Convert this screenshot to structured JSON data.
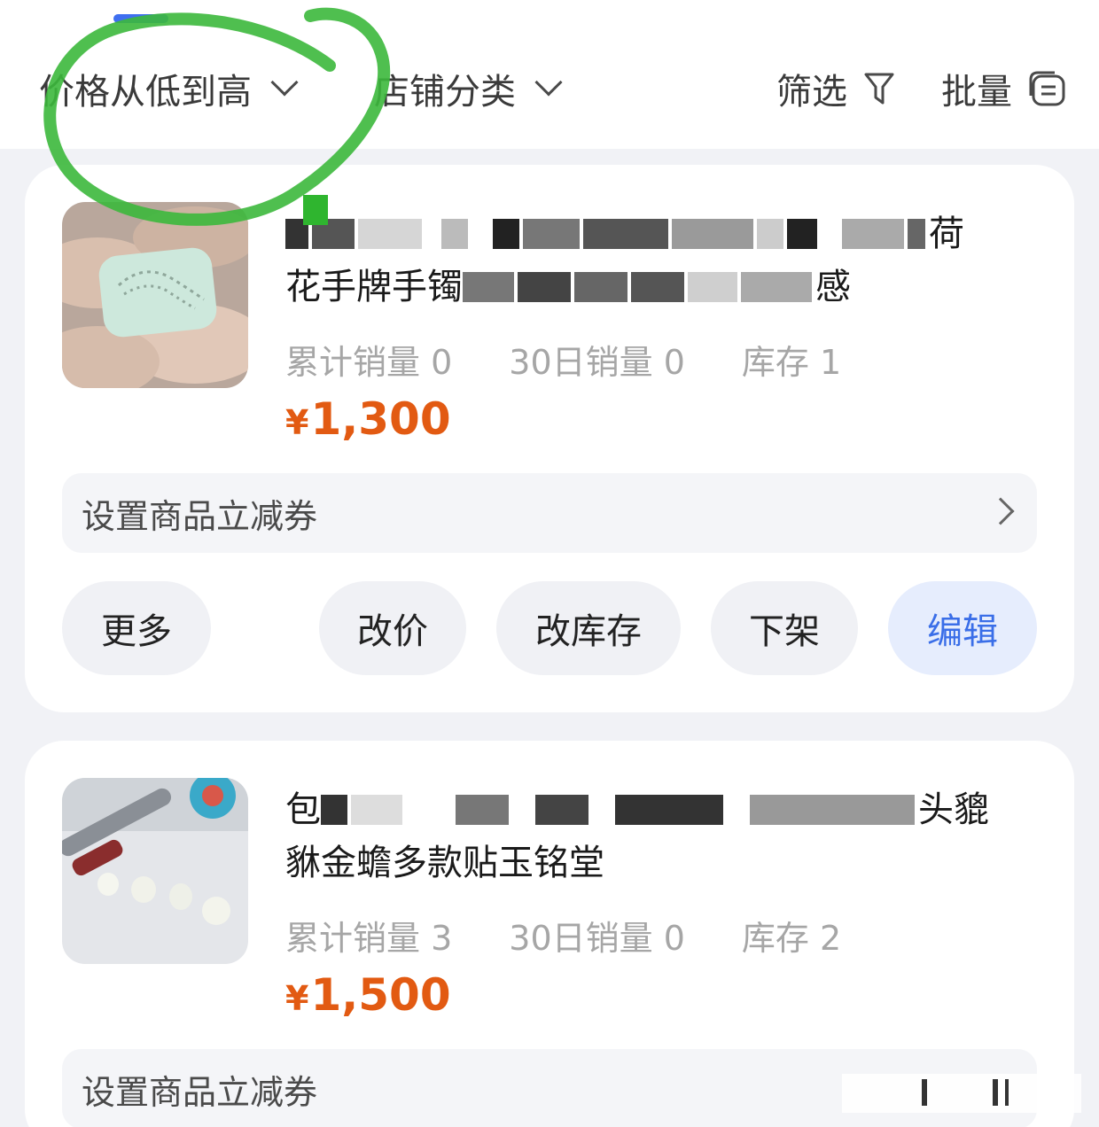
{
  "filter_bar": {
    "sort_label": "价格从低到高",
    "category_label": "店铺分类",
    "filter_label": "筛选",
    "batch_label": "批量"
  },
  "products": [
    {
      "title_line1_end": "荷",
      "title_line2_start": "花手牌手镯",
      "title_line2_end": "感",
      "total_sales": "累计销量 0",
      "sales_30d": "30日销量 0",
      "stock": "库存 1",
      "price_symbol": "¥",
      "price": "1,300",
      "coupon_label": "设置商品立减券",
      "buttons": {
        "more": "更多",
        "change_price": "改价",
        "change_stock": "改库存",
        "delist": "下架",
        "edit": "编辑"
      }
    },
    {
      "title_line1_start": "包",
      "title_line1_end": "头貔",
      "title_line2": "貅金蟾多款贴玉铭堂",
      "total_sales": "累计销量 3",
      "sales_30d": "30日销量 0",
      "stock": "库存 2",
      "price_symbol": "¥",
      "price": "1,500",
      "coupon_label": "设置商品立减券"
    }
  ],
  "colors": {
    "accent": "#3a6ee8",
    "price": "#e25a12",
    "annotation": "#3cb83c"
  },
  "icons": [
    "chevron-down-icon",
    "filter-funnel-icon",
    "batch-list-icon",
    "chevron-right-icon"
  ]
}
